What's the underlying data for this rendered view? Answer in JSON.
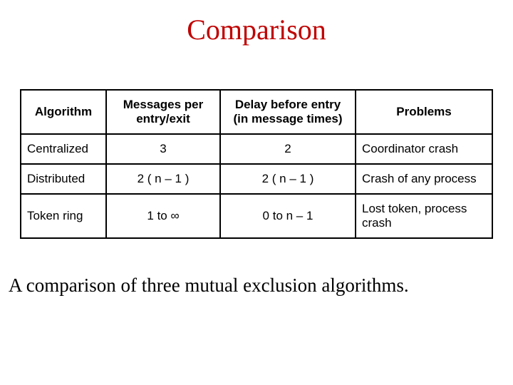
{
  "title": "Comparison",
  "headers": {
    "algorithm": "Algorithm",
    "messages": "Messages per entry/exit",
    "delay": "Delay before entry (in message times)",
    "problems": "Problems"
  },
  "rows": [
    {
      "algorithm": "Centralized",
      "messages": "3",
      "delay": "2",
      "problems": "Coordinator crash"
    },
    {
      "algorithm": "Distributed",
      "messages": "2 ( n – 1 )",
      "delay": "2 ( n – 1 )",
      "problems": "Crash of any process"
    },
    {
      "algorithm": "Token ring",
      "messages": "1 to ∞",
      "delay": "0 to n – 1",
      "problems": "Lost token, process crash"
    }
  ],
  "caption": "A comparison of three mutual exclusion algorithms."
}
